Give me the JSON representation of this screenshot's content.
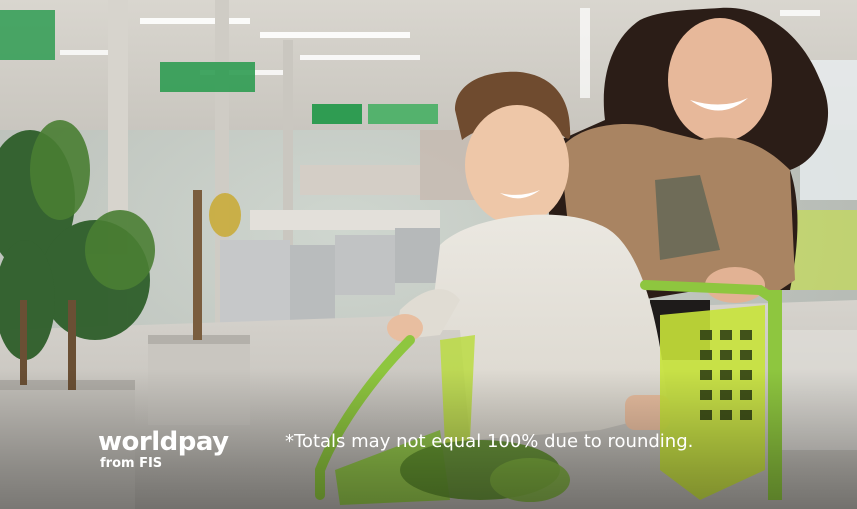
{
  "brand": {
    "logo_word": "worldpay",
    "logo_sub": "from FIS"
  },
  "footnote": "*Totals may not equal 100% due to rounding.",
  "photo": {
    "subject": "shopping-cart-photo"
  },
  "colors": {
    "cart_green": "#8ec63f",
    "cart_lime": "#c8e33a",
    "store_sign_green": "#2f9c52",
    "text_white": "#ffffff"
  }
}
